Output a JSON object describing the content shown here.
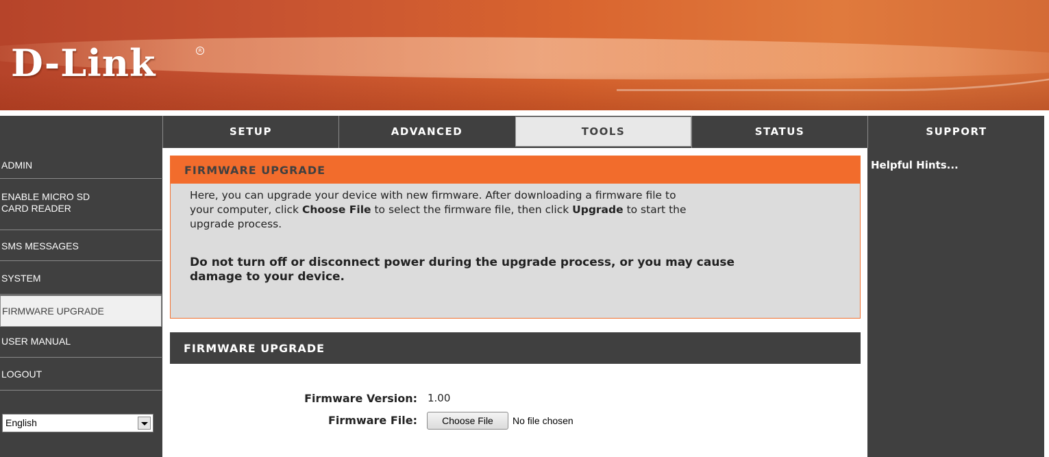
{
  "brand": {
    "logo_text": "D-Link",
    "registered_mark": "R"
  },
  "colors": {
    "orange": "#f26c2c",
    "dark": "#404040",
    "active_tab": "#e8e8e8"
  },
  "topnav": {
    "tabs": [
      {
        "label": "SETUP"
      },
      {
        "label": "ADVANCED"
      },
      {
        "label": "TOOLS",
        "active": true
      },
      {
        "label": "STATUS"
      },
      {
        "label": "SUPPORT"
      }
    ]
  },
  "sidebar": {
    "items": [
      {
        "label": "ADMIN"
      },
      {
        "label": "ENABLE MICRO SD",
        "label2": "CARD READER"
      },
      {
        "label": "SMS MESSAGES"
      },
      {
        "label": "SYSTEM"
      },
      {
        "label": "FIRMWARE UPGRADE",
        "active": true
      },
      {
        "label": "USER MANUAL"
      },
      {
        "label": "LOGOUT"
      }
    ],
    "language": {
      "selected": "English"
    }
  },
  "intro_box": {
    "title": "FIRMWARE UPGRADE",
    "line1": "Here, you can upgrade your device with new firmware. After downloading a firmware file to",
    "line2_pre": "your computer, click ",
    "line2_bold1": "Choose File",
    "line2_mid": " to select the firmware file, then click ",
    "line2_bold2": "Upgrade",
    "line2_post": " to start the",
    "line3": "upgrade process.",
    "warning_line1": "Do not turn off or disconnect power during the upgrade process, or you may cause",
    "warning_line2": "damage to your device."
  },
  "upgrade_box": {
    "title": "FIRMWARE UPGRADE",
    "version_label": "Firmware Version:",
    "version_value": "1.00",
    "file_label": "Firmware File:",
    "choose_file_button": "Choose File",
    "no_file_text": "No file chosen"
  },
  "help": {
    "title": "Helpful Hints..."
  }
}
